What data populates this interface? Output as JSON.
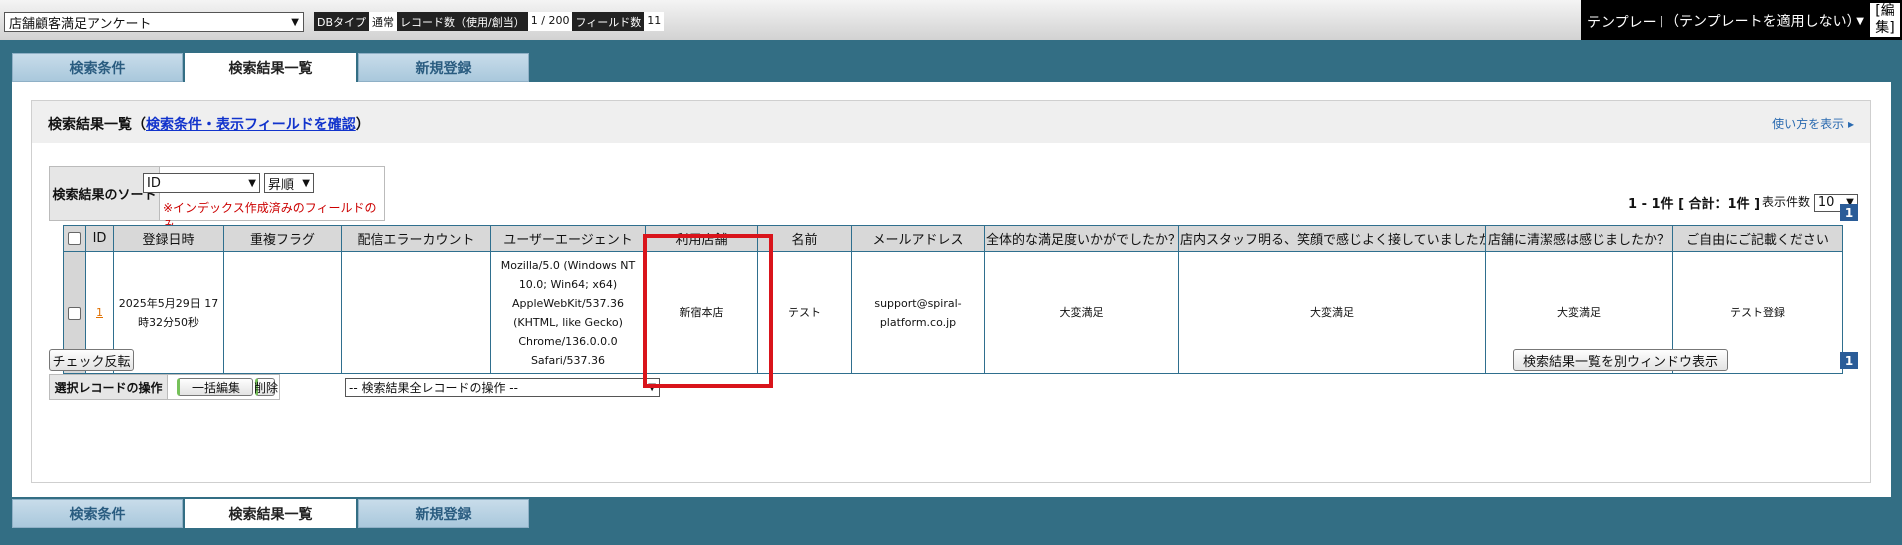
{
  "topbar": {
    "db_name": "店舗顧客満足アンケート",
    "db_type_label": "DBタイプ",
    "db_type_value": "通常",
    "record_count_label": "レコード数（使用/創当）",
    "record_count_value": "1 / 200",
    "field_count_label": "フィールド数",
    "field_count_value": "11",
    "template_label": "テンプレート",
    "template_value": "（テンプレートを適用しない）",
    "edit_label": "[編集]"
  },
  "tabs": [
    {
      "label": "検索条件"
    },
    {
      "label": "検索結果一覧"
    },
    {
      "label": "新規登録"
    }
  ],
  "results": {
    "title": "検索結果一覧",
    "title_link": "検索条件・表示フィールドを確認",
    "howto": "使い方を表示 ▸",
    "sort_label": "検索結果のソート",
    "sort_field": "ID",
    "sort_order": "昇順",
    "sort_note": "※インデックス作成済みのフィールドのみ",
    "count_text": "1 - 1件 [ 合計：1件 ]",
    "per_page_label": "表示件数",
    "per_page_value": "10",
    "page_number": "1",
    "columns": [
      "ID",
      "登録日時",
      "重複フラグ",
      "配信エラーカウント",
      "ユーザーエージェント",
      "利用店舗",
      "名前",
      "メールアドレス",
      "全体的な満足度いかがでしたか？",
      "店内スタッフ明る、笑顔で感じよく接していましたか？",
      "店舗に清潔感は感じましたか？",
      "ご自由にご記載ください"
    ],
    "rows": [
      {
        "id": "1",
        "registered": "2025年5月29日 17時32分50秒",
        "dup_flag": "",
        "error_count": "",
        "user_agent": "Mozilla/5.0 (Windows NT 10.0; Win64; x64) AppleWebKit/537.36 (KHTML, like Gecko) Chrome/136.0.0.0 Safari/537.36",
        "store": "新宿本店",
        "name": "テスト",
        "email": "support@spiral-platform.co.jp",
        "q1": "大変満足",
        "q2": "大変満足",
        "q3": "大変満足",
        "comment": "テスト登録"
      }
    ],
    "toggle_check_button": "チェック反転",
    "open_window_button": "検索結果一覧を別ウィンドウ表示",
    "selected_ops_label": "選択レコードの操作",
    "bulk_edit_button": "一括編集",
    "delete_button": "削除",
    "all_ops_select": "-- 検索結果全レコードの操作 --"
  },
  "colors": {
    "background": "#336e84",
    "highlight": "#d9141b",
    "tab": "#a9c8dc"
  }
}
